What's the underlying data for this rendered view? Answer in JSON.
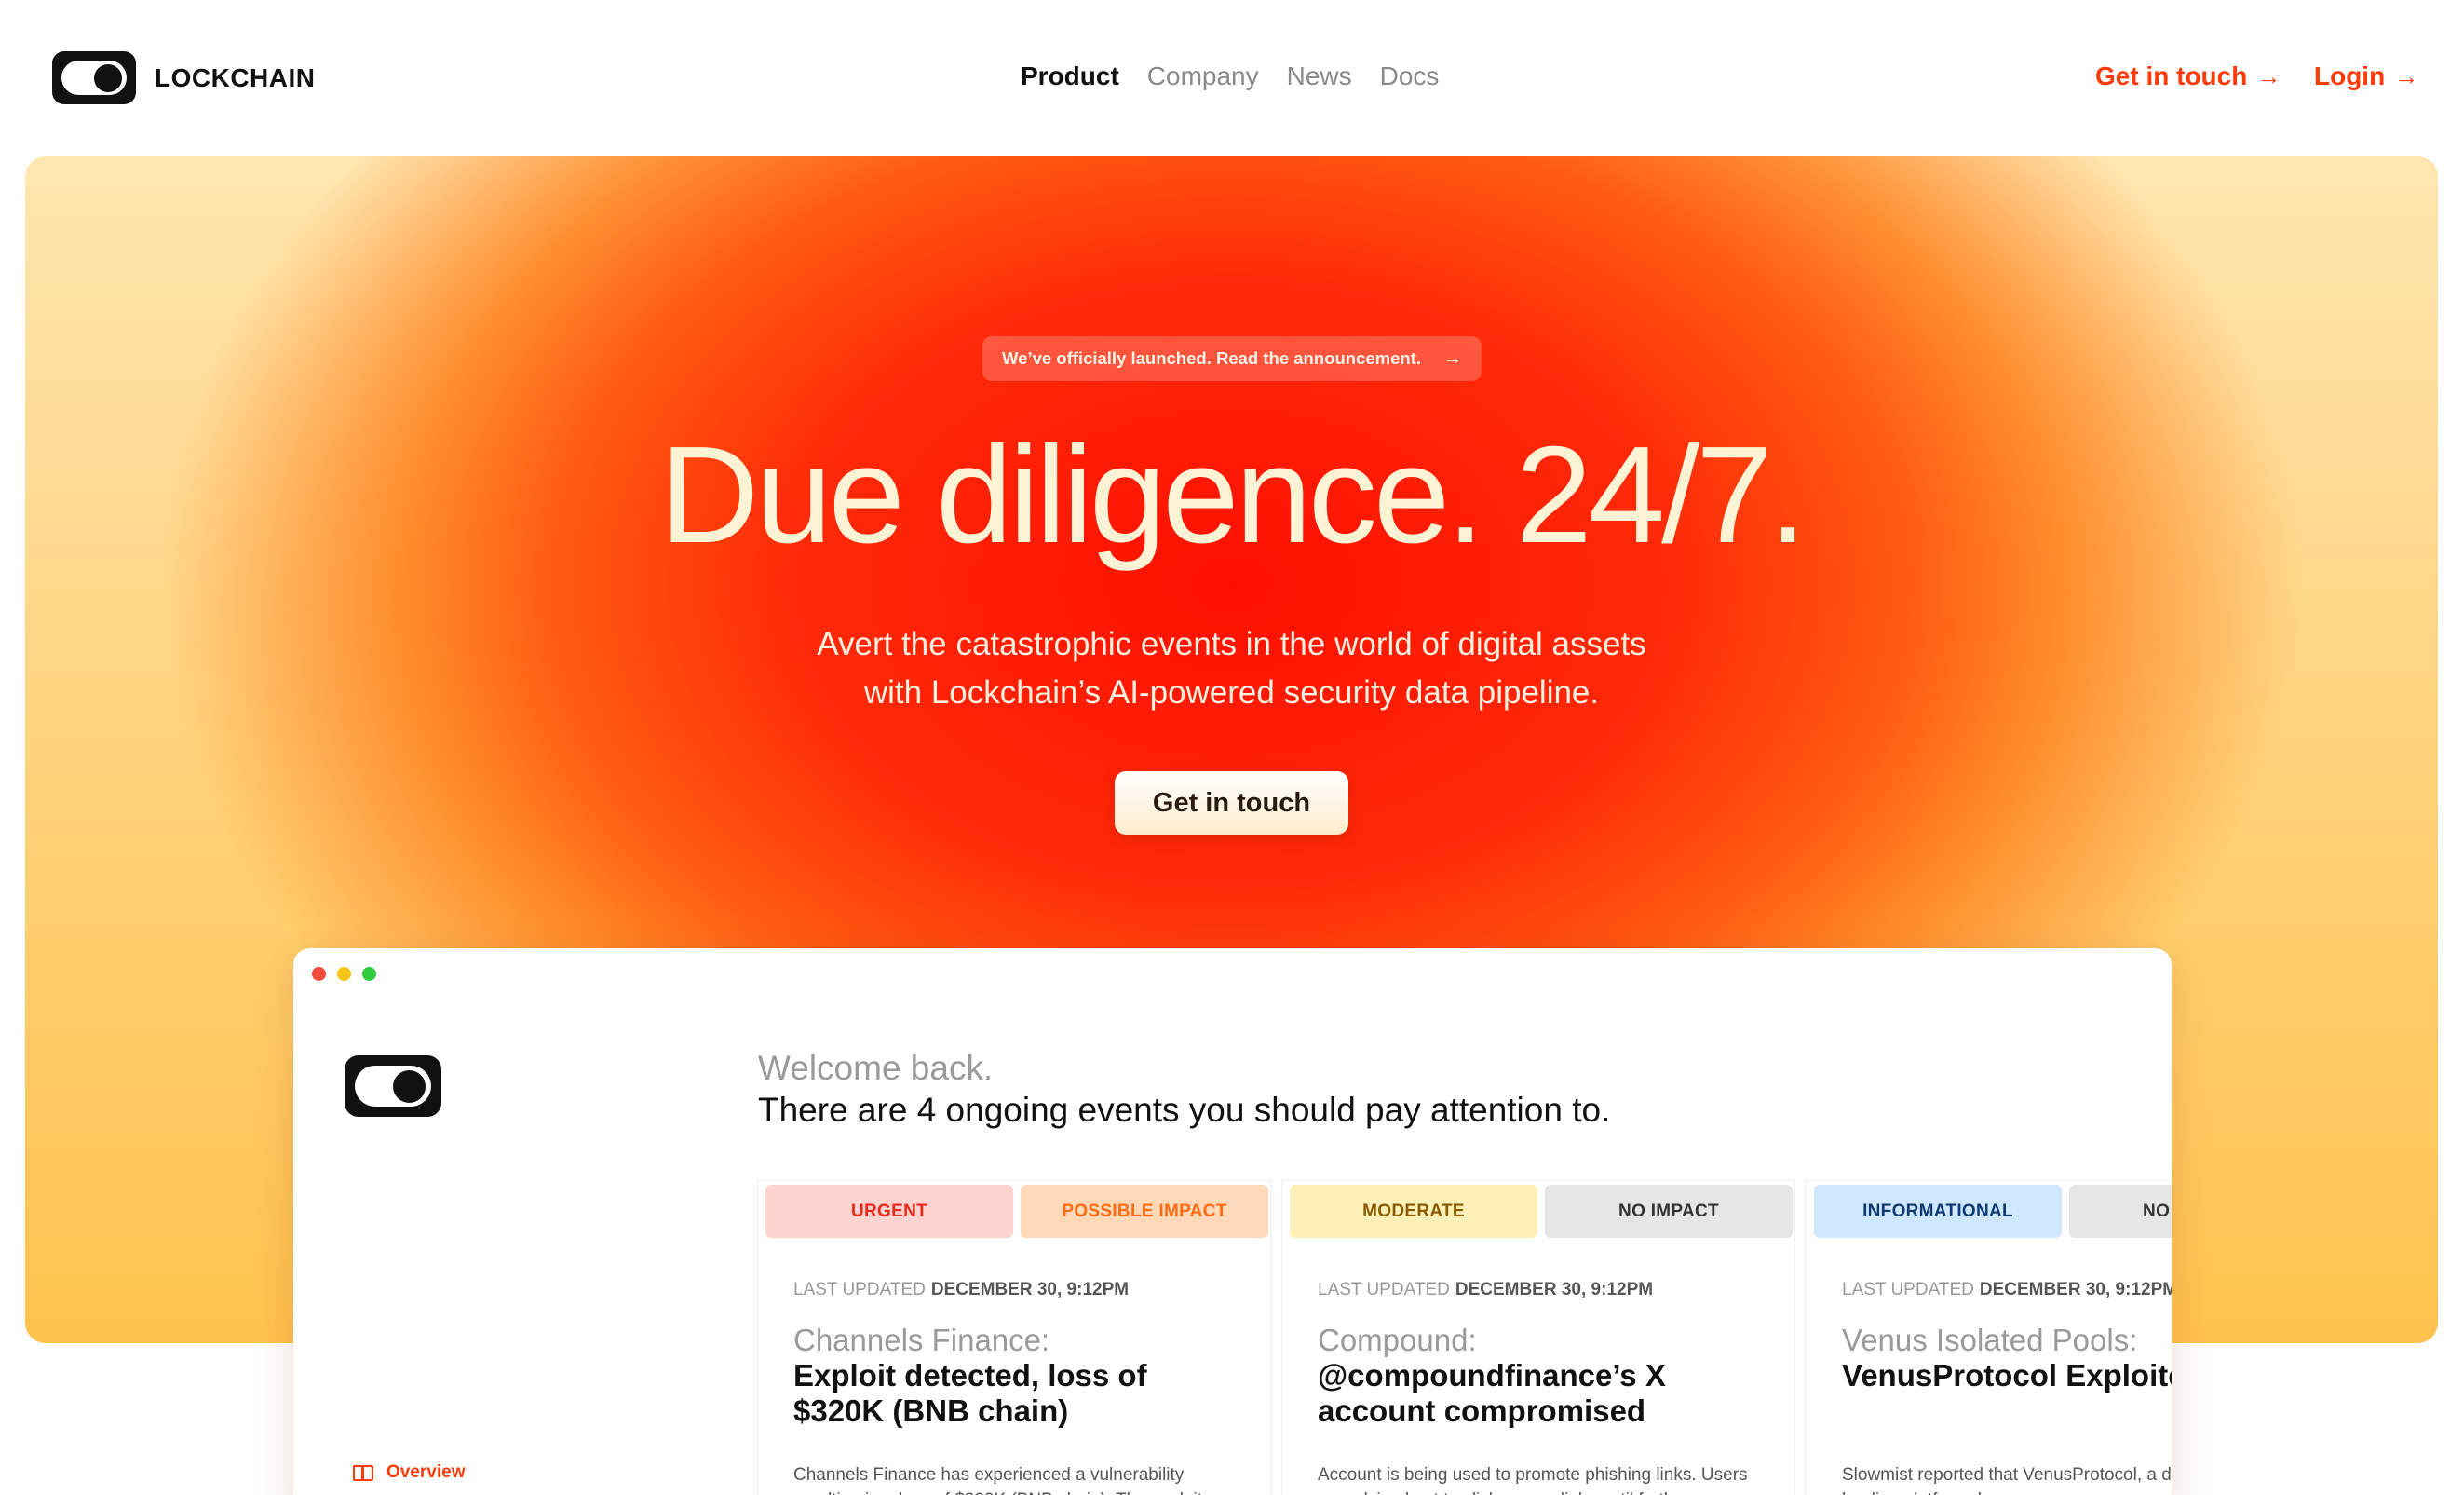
{
  "brand": {
    "name": "LOCKCHAIN"
  },
  "nav": {
    "links": [
      {
        "label": "Product",
        "active": true
      },
      {
        "label": "Company",
        "active": false
      },
      {
        "label": "News",
        "active": false
      },
      {
        "label": "Docs",
        "active": false
      }
    ],
    "cta_label": "Get in touch",
    "login_label": "Login",
    "arrow": "→"
  },
  "hero": {
    "announcement": "We’ve officially launched. Read the announcement.",
    "announcement_arrow": "→",
    "title": "Due diligence. 24/7.",
    "subtitle_line1": "Avert the catastrophic events in the world of digital assets",
    "subtitle_line2": "with Lockchain’s AI-powered security data pipeline.",
    "button": "Get in touch"
  },
  "colors": {
    "accent": "#ff3b0a",
    "hero_red": "#ff1a00",
    "hero_yellow": "#ffc24d"
  },
  "app": {
    "welcome": "Welcome back.",
    "headline": "There are 4 ongoing events you should pay attention to.",
    "sidebar": {
      "overview_label": "Overview",
      "overview_icon": "book-icon"
    },
    "columns": [
      {
        "tags": [
          "URGENT",
          "POSSIBLE IMPACT"
        ],
        "updated_label": "LAST UPDATED",
        "updated_value": "DECEMBER 30, 9:12PM",
        "pre_title": "Channels Finance:",
        "title": "Exploit detected, loss of $320K (BNB chain)",
        "description": "Channels Finance has experienced a vulnerability resulting in a loss of $320K (BNB chain). The exploit"
      },
      {
        "tags": [
          "MODERATE",
          "NO IMPACT"
        ],
        "updated_label": "LAST UPDATED",
        "updated_value": "DECEMBER 30, 9:12PM",
        "pre_title": "Compound:",
        "title": "@compoundfinance’s X account compromised",
        "description": "Account is being used to promote phishing links. Users are advised not to click on any links until further"
      },
      {
        "tags": [
          "INFORMATIONAL",
          "NO IMPACT"
        ],
        "updated_label": "LAST UPDATED",
        "updated_value": "DECEMBER 30, 9:12PM",
        "pre_title": "Venus Isolated Pools:",
        "title": "VenusProtocol Exploited",
        "description": "Slowmist reported that VenusProtocol, a decentralized lending platform, has rec"
      }
    ]
  }
}
